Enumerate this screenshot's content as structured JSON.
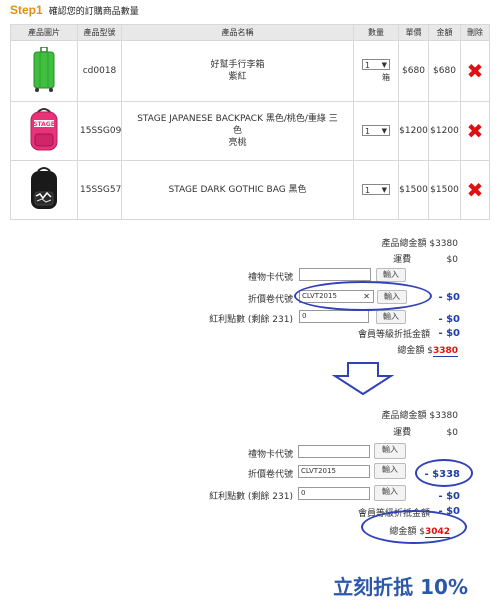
{
  "step": {
    "number": "Step1",
    "title": "確認您的訂購商品數量"
  },
  "table": {
    "headers": [
      "產品圖片",
      "產品型號",
      "產品名稱",
      "數量",
      "單價",
      "金額",
      "刪除"
    ],
    "rows": [
      {
        "model": "cd0018",
        "name_line1": "好幫手行李箱",
        "name_line2": "紫紅",
        "name_line3": "",
        "qty": "1",
        "unit": "箱",
        "price": "$680",
        "amount": "$680",
        "image": "green-suitcase"
      },
      {
        "model": "15SSG09",
        "name_line1": "STAGE JAPANESE BACKPACK 黑色/桃色/重綠 三",
        "name_line2": "色",
        "name_line3": "亮桃",
        "qty": "1",
        "unit": "",
        "price": "$1200",
        "amount": "$1200",
        "image": "pink-backpack"
      },
      {
        "model": "15SSG57",
        "name_line1": "STAGE DARK GOTHIC BAG 黑色",
        "name_line2": "",
        "name_line3": "",
        "qty": "1",
        "unit": "",
        "price": "$1500",
        "amount": "$1500",
        "image": "black-backpack"
      }
    ]
  },
  "summary_before": {
    "subtotal_label": "產品總金額",
    "subtotal": "$3380",
    "shipping_label": "運費",
    "shipping": "$0",
    "giftcard_label": "禮物卡代號",
    "giftcard_value": "",
    "giftcard_btn": "輸入",
    "coupon_label": "折價卷代號",
    "coupon_value": "CLVT2015",
    "coupon_btn": "輸入",
    "coupon_discount": "- $0",
    "points_label": "紅利點數 (剩餘 231)",
    "points_value": "0",
    "points_btn": "輸入",
    "points_discount": "- $0",
    "member_label": "會員等級折抵金額",
    "member_discount": "- $0",
    "total_label": "總金額",
    "total_prefix": "$",
    "total_value": "3380"
  },
  "summary_after": {
    "subtotal_label": "產品總金額",
    "subtotal": "$3380",
    "shipping_label": "運費",
    "shipping": "$0",
    "giftcard_label": "禮物卡代號",
    "giftcard_value": "",
    "giftcard_btn": "輸入",
    "coupon_label": "折價卷代號",
    "coupon_value": "CLVT2015",
    "coupon_btn": "輸入",
    "coupon_discount": "- $338",
    "points_label": "紅利點數 (剩餘 231)",
    "points_value": "0",
    "points_btn": "輸入",
    "points_discount": "- $0",
    "member_label": "會員等級折抵金額",
    "member_discount": "- $0",
    "total_label": "總金額",
    "total_prefix": "$",
    "total_value": "3042"
  },
  "callout": "立刻折抵 10%",
  "colors": {
    "step": "#e0900f",
    "delete": "#e01010",
    "annotation": "#3142b8",
    "discount": "#1e3fa8"
  }
}
